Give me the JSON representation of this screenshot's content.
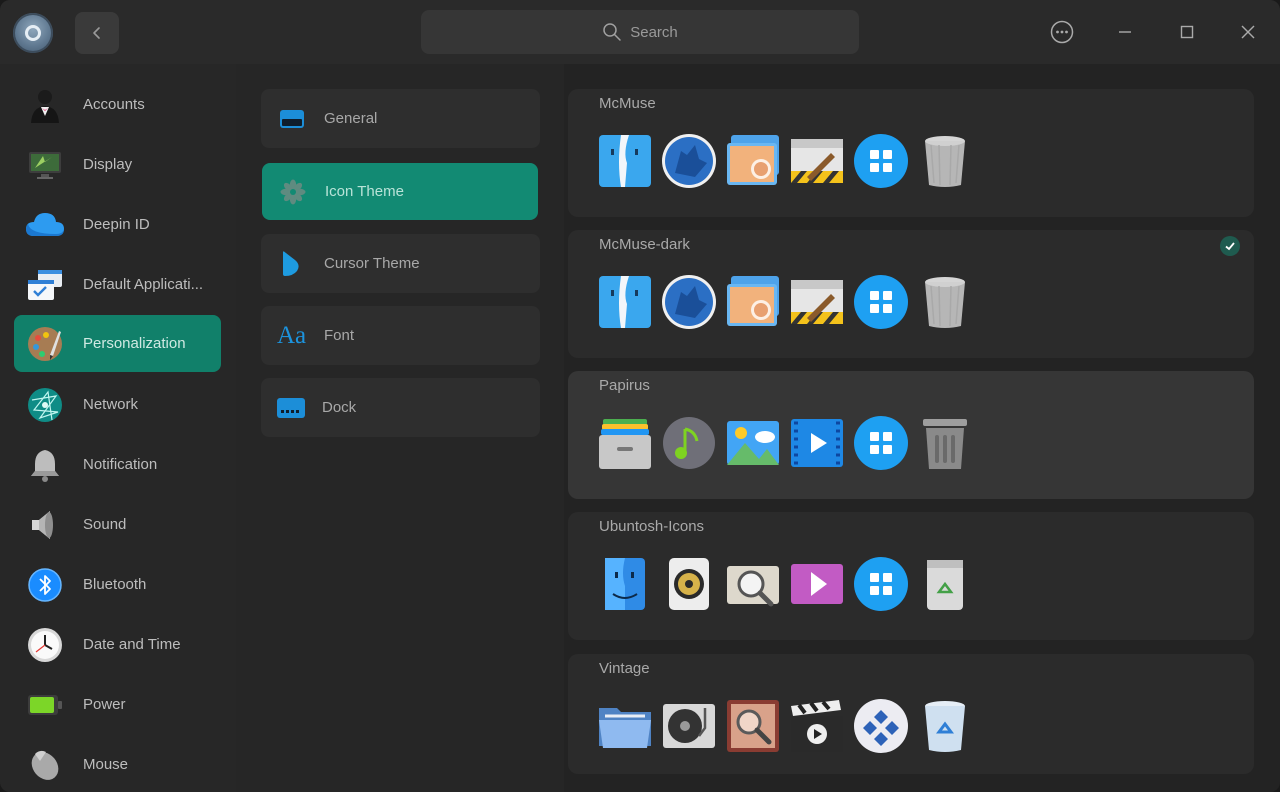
{
  "search": {
    "placeholder": "Search"
  },
  "nav": {
    "items": [
      {
        "label": "Accounts",
        "icon": "accounts-icon"
      },
      {
        "label": "Display",
        "icon": "display-icon"
      },
      {
        "label": "Deepin ID",
        "icon": "cloud-icon"
      },
      {
        "label": "Default Applicati...",
        "icon": "default-apps-icon"
      },
      {
        "label": "Personalization",
        "icon": "palette-icon",
        "active": true
      },
      {
        "label": "Network",
        "icon": "network-icon"
      },
      {
        "label": "Notification",
        "icon": "bell-icon"
      },
      {
        "label": "Sound",
        "icon": "speaker-icon"
      },
      {
        "label": "Bluetooth",
        "icon": "bluetooth-icon"
      },
      {
        "label": "Date and Time",
        "icon": "clock-icon"
      },
      {
        "label": "Power",
        "icon": "battery-icon"
      },
      {
        "label": "Mouse",
        "icon": "mouse-icon"
      }
    ]
  },
  "sections": {
    "items": [
      {
        "label": "General",
        "icon": "window-icon"
      },
      {
        "label": "Icon Theme",
        "icon": "flower-icon",
        "active": true
      },
      {
        "label": "Cursor Theme",
        "icon": "cursor-icon"
      },
      {
        "label": "Font",
        "icon": "font-icon",
        "glyph": "Aa"
      },
      {
        "label": "Dock",
        "icon": "dock-icon"
      }
    ]
  },
  "themes": {
    "items": [
      {
        "name": "McMuse",
        "selected": false
      },
      {
        "name": "McMuse-dark",
        "selected": true
      },
      {
        "name": "Papirus",
        "selected": false
      },
      {
        "name": "Ubuntosh-Icons",
        "selected": false
      },
      {
        "name": "Vintage",
        "selected": false
      }
    ]
  },
  "colors": {
    "accent": "#11806a",
    "accent_light": "#128a73",
    "background": "#252525"
  }
}
